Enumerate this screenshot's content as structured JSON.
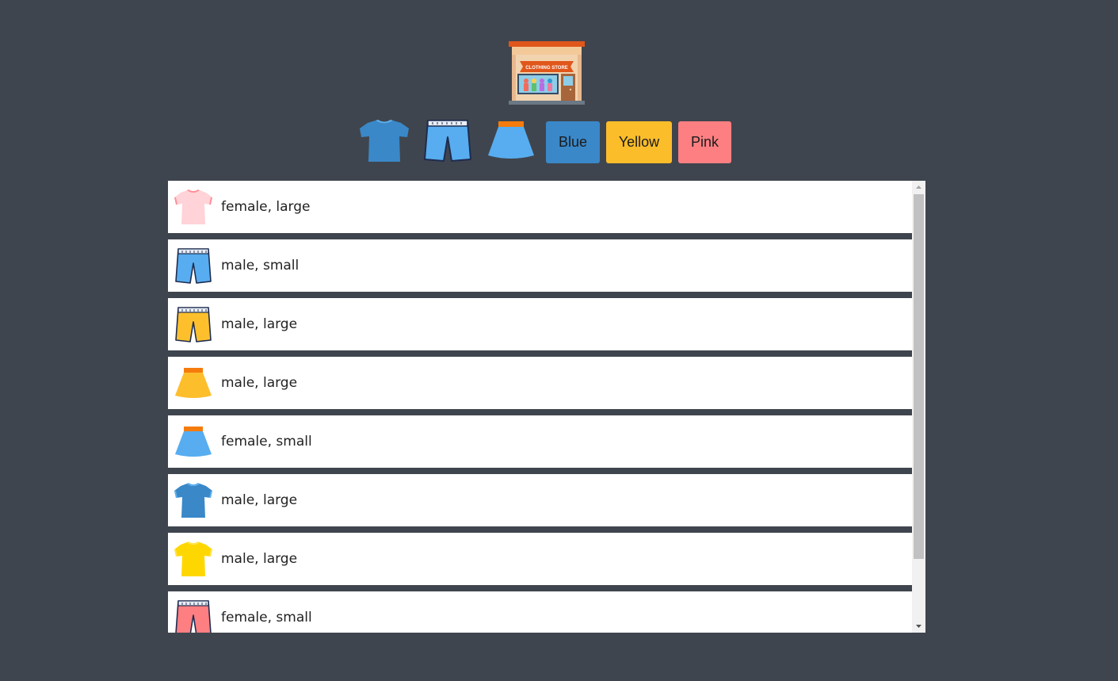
{
  "store": {
    "sign": "CLOTHING STORE"
  },
  "filters": {
    "icons": [
      "tshirt-icon",
      "shorts-icon",
      "skirt-icon"
    ],
    "colors": [
      {
        "label": "Blue",
        "color": "#3a88c8"
      },
      {
        "label": "Yellow",
        "color": "#fbbd2a"
      },
      {
        "label": "Pink",
        "color": "#fd7f82"
      }
    ]
  },
  "items": [
    {
      "type": "tshirt",
      "color": "#ffd3d7",
      "trim": "#ff8e98",
      "label": "female, large"
    },
    {
      "type": "shorts",
      "color": "#57adf0",
      "trim": "#1e2c4f",
      "label": "male, small"
    },
    {
      "type": "shorts",
      "color": "#fdc02c",
      "trim": "#1e2c4f",
      "label": "male, large"
    },
    {
      "type": "skirt",
      "color": "#fdbe2c",
      "trim": "#f57c0c",
      "label": "male, large"
    },
    {
      "type": "skirt",
      "color": "#57adf0",
      "trim": "#f57c0c",
      "label": "female, small"
    },
    {
      "type": "tshirt",
      "color": "#3a88c8",
      "trim": "#5ab0f0",
      "label": "male, large"
    },
    {
      "type": "tshirt",
      "color": "#ffd700",
      "trim": "#ffe44d",
      "label": "male, large"
    },
    {
      "type": "shorts",
      "color": "#fd7f82",
      "trim": "#1e2c4f",
      "label": "female, small"
    }
  ]
}
